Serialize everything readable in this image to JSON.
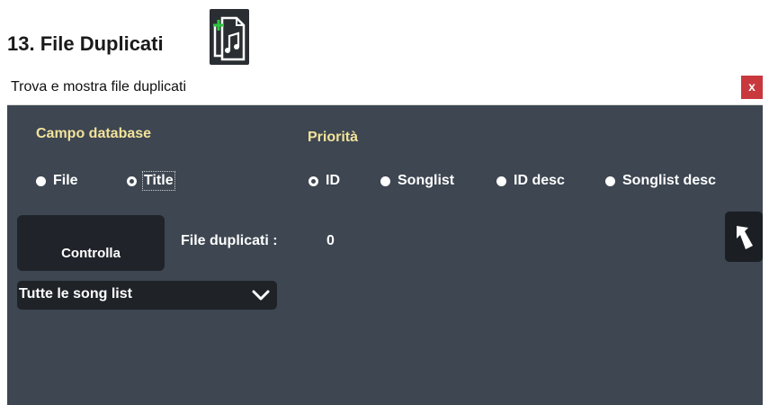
{
  "heading": {
    "title": "13. File Duplicati"
  },
  "window": {
    "title": "Trova e mostra file duplicati",
    "close_label": "x"
  },
  "campo": {
    "label": "Campo database",
    "options": [
      {
        "label": "File",
        "checked": false
      },
      {
        "label": "Title",
        "checked": true
      }
    ]
  },
  "priorita": {
    "label": "Priorità",
    "options": [
      {
        "label": "ID",
        "checked": true
      },
      {
        "label": "Songlist",
        "checked": false
      },
      {
        "label": "ID desc",
        "checked": false
      },
      {
        "label": "Songlist desc",
        "checked": false
      }
    ]
  },
  "check_button": {
    "label": "Controlla"
  },
  "duplicates": {
    "label": "File duplicati :",
    "count": "0"
  },
  "songlist_select": {
    "selected": "Tutte le song list"
  },
  "icons": {
    "heading_icon": "music-file-duplicate-icon",
    "undo": "undo-arrow-icon",
    "dropdown": "chevron-down-icon"
  },
  "colors": {
    "panel_bg": "#3d4651",
    "button_bg": "#20242a",
    "label_gold": "#f2e39a",
    "close_red": "#c8383d",
    "icon_green": "#2fc63f"
  }
}
